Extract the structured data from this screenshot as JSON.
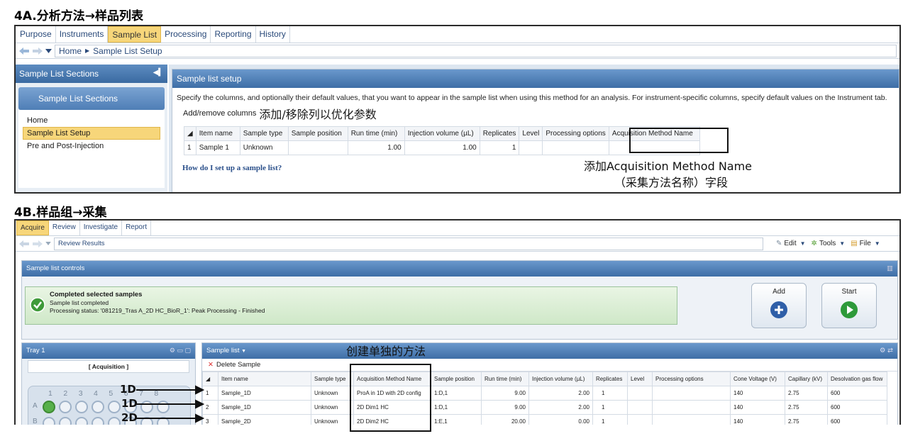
{
  "section_a": {
    "title": "4A.分析方法→样品列表",
    "tabs": [
      "Purpose",
      "Instruments",
      "Sample List",
      "Processing",
      "Reporting",
      "History"
    ],
    "active_tab": "Sample List",
    "breadcrumb": [
      "Home",
      "Sample List Setup"
    ],
    "left_panel": {
      "header": "Sample List Sections",
      "card": "Sample List Sections",
      "items": [
        "Home",
        "Sample List Setup",
        "Pre and Post-Injection"
      ],
      "selected": "Sample List Setup"
    },
    "main": {
      "header": "Sample list setup",
      "description": "Specify the columns, and optionally their default values, that you want to appear in the sample list when using this method for an analysis. For instrument-specific columns, specify default values on the Instrument tab.",
      "add_remove_label": "Add/remove columns",
      "add_remove_annotation": "添加/移除列以优化参数",
      "columns": [
        "Item name",
        "Sample type",
        "Sample position",
        "Run time (min)",
        "Injection volume (µL)",
        "Replicates",
        "Level",
        "Processing options",
        "Acquisition Method Name"
      ],
      "rows": [
        {
          "index": "1",
          "cells": [
            "Sample 1",
            "Unknown",
            "",
            "1.00",
            "1.00",
            "1",
            "",
            "",
            ""
          ]
        }
      ],
      "help_link": "How do I set up a sample list?"
    },
    "annotation_line1": "添加Acquisition Method Name",
    "annotation_line2": "（采集方法名称）字段"
  },
  "section_b": {
    "title": "4B.样品组→采集",
    "tabs": [
      "Acquire",
      "Review",
      "Investigate",
      "Report"
    ],
    "active_tab": "Acquire",
    "breadcrumb": "Review Results",
    "toolbar": {
      "edit": "Edit",
      "tools": "Tools",
      "file": "File"
    },
    "controls_header": "Sample list controls",
    "status": {
      "title": "Completed selected samples",
      "line1": "Sample list completed",
      "line2": "Processing status: '081219_Tras A_2D HC_BioR_1': Peak Processing - Finished"
    },
    "add_button": "Add",
    "start_button": "Start",
    "tray": {
      "header": "Tray 1",
      "subheader": "[ Acquisition ]",
      "col_labels": [
        "1",
        "2",
        "3",
        "4",
        "5",
        "6",
        "7",
        "8"
      ],
      "row_labels": [
        "A",
        "B"
      ]
    },
    "sample_list_header": "Sample list",
    "delete_label": "Delete Sample",
    "annotation_separate": "创建单独的方法",
    "columns": [
      "Item name",
      "Sample type",
      "Acquisition Method Name",
      "Sample position",
      "Run time (min)",
      "Injection volume (µL)",
      "Replicates",
      "Level",
      "Processing options",
      "Cone Voltage (V)",
      "Capillary (kV)",
      "Desolvation gas flow"
    ],
    "rows": [
      {
        "index": "1",
        "cells": [
          "Sample_1D",
          "Unknown",
          "ProA in 1D with 2D config",
          "1:D,1",
          "9.00",
          "2.00",
          "1",
          "",
          "",
          "140",
          "2.75",
          "600"
        ]
      },
      {
        "index": "2",
        "cells": [
          "Sample_1D",
          "Unknown",
          "2D Dim1 HC",
          "1:D,1",
          "9.00",
          "2.00",
          "1",
          "",
          "",
          "140",
          "2.75",
          "600"
        ]
      },
      {
        "index": "3",
        "cells": [
          "Sample_2D",
          "Unknown",
          "2D Dim2 HC",
          "1:E,1",
          "20.00",
          "0.00",
          "1",
          "",
          "",
          "140",
          "2.75",
          "600"
        ]
      }
    ],
    "arrow_labels": [
      "1D",
      "1D",
      "2D"
    ]
  }
}
